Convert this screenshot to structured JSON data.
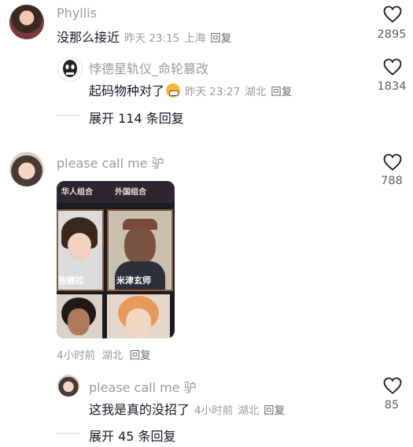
{
  "comments": [
    {
      "username": "Phyllis",
      "text": "没那么接近",
      "time": "昨天 23:15",
      "location": "上海",
      "reply_label": "回复",
      "likes": "2895"
    },
    {
      "username": "悖德星轨仪_命轮篡改",
      "text": "起码物种对了",
      "time": "昨天 23:27",
      "location": "湖北",
      "reply_label": "回复",
      "likes": "1834"
    },
    {
      "username": "please call me 驴",
      "time": "4小时前",
      "location": "湖北",
      "reply_label": "回复",
      "likes": "788",
      "image_labels": [
        "华人组合",
        "外国组合",
        "张娜拉",
        "米津玄师"
      ]
    },
    {
      "username": "please call me 驴",
      "text": "这我是真的没招了",
      "time": "4小时前",
      "location": "湖北",
      "reply_label": "回复",
      "likes": "85"
    }
  ],
  "expand_1": "展开 114 条回复",
  "expand_2": "展开 45 条回复",
  "colors": {
    "text": "#161823",
    "muted": "#9a9a9f",
    "divider": "#d9d9dd"
  }
}
